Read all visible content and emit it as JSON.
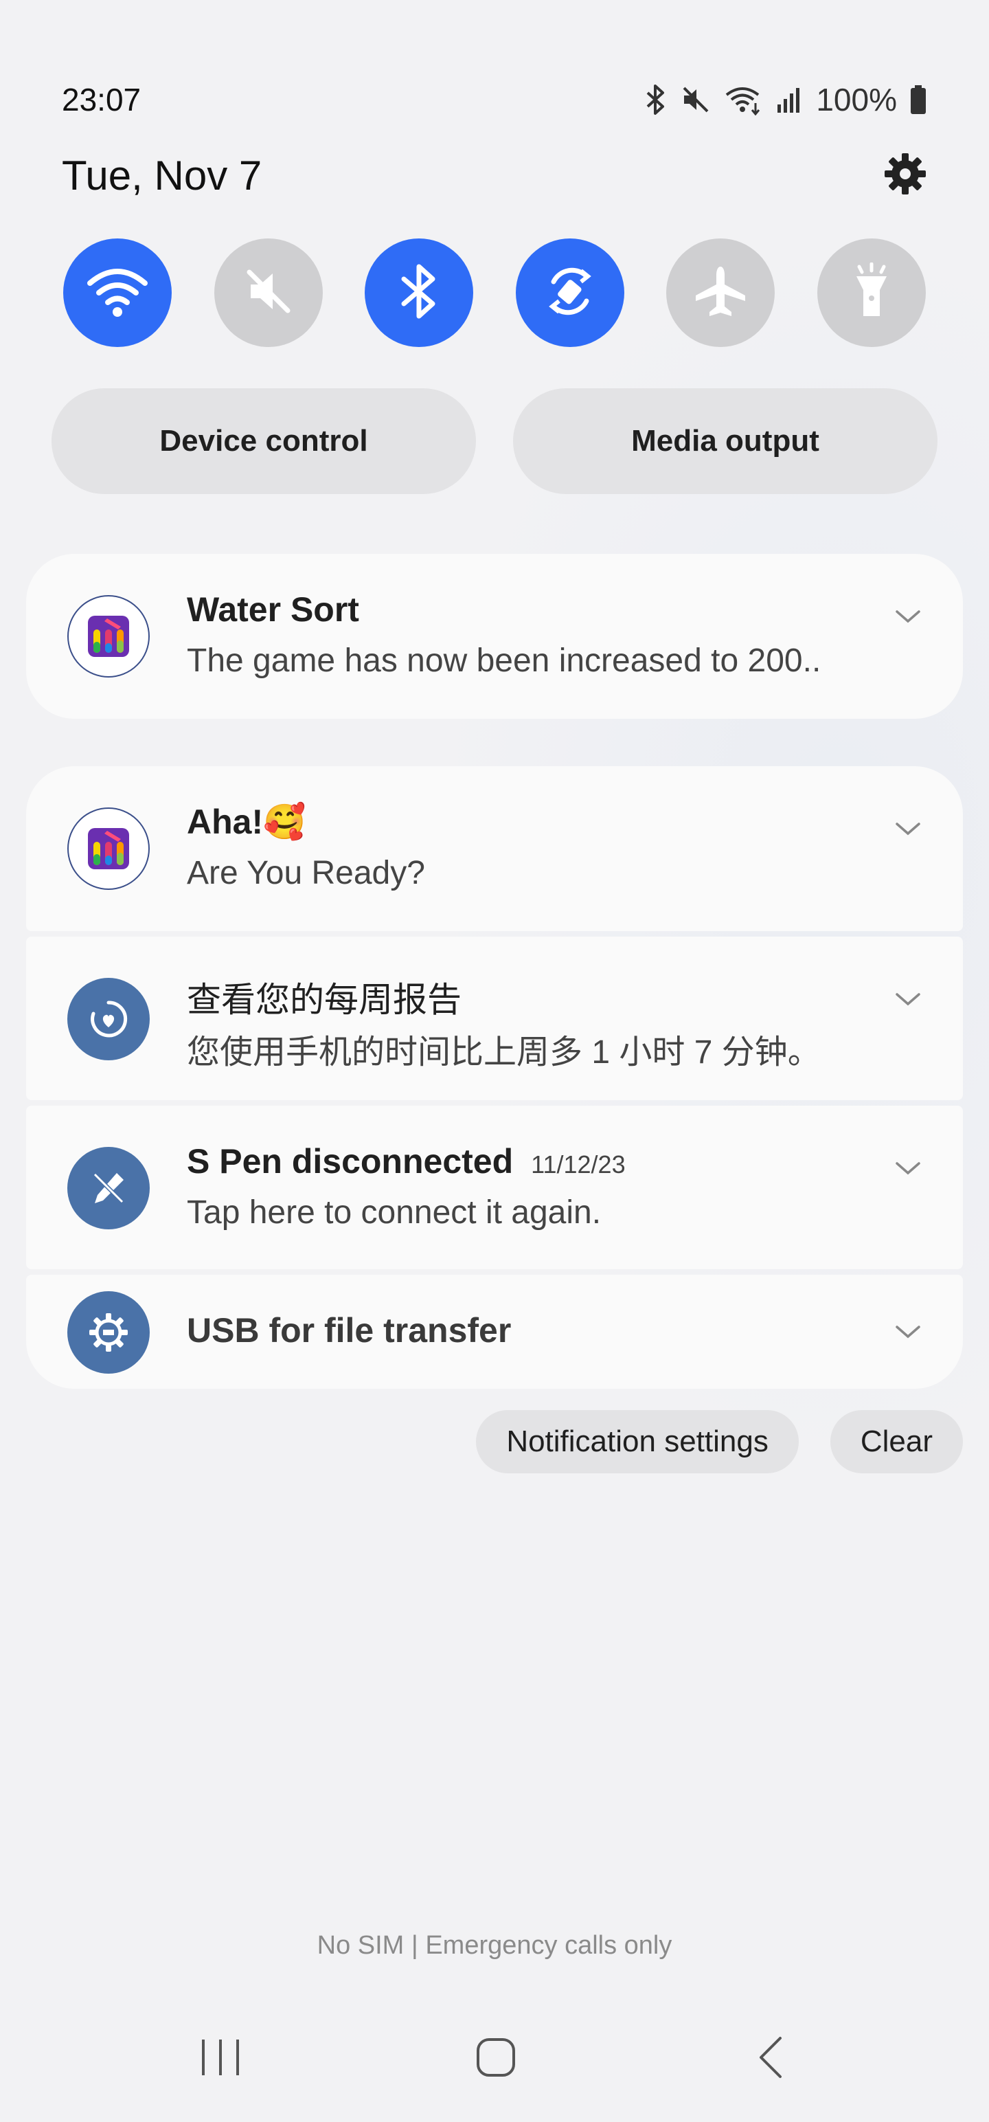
{
  "status_bar": {
    "time": "23:07",
    "battery": "100%",
    "icons": [
      "bluetooth-icon",
      "mute-icon",
      "wifi-icon",
      "signal-icon",
      "battery-icon"
    ]
  },
  "header": {
    "date": "Tue, Nov 7",
    "settings_icon": "gear-icon"
  },
  "quick_toggles": [
    {
      "name": "wifi",
      "on": true
    },
    {
      "name": "sound-mute",
      "on": false
    },
    {
      "name": "bluetooth",
      "on": true
    },
    {
      "name": "auto-rotate",
      "on": true
    },
    {
      "name": "airplane-mode",
      "on": false
    },
    {
      "name": "flashlight",
      "on": false
    }
  ],
  "controls": {
    "device_control": "Device control",
    "media_output": "Media output"
  },
  "notifications": {
    "water_sort": {
      "title": "Water Sort",
      "text": "The game has now been increased to 200.."
    },
    "aha": {
      "title": "Aha!🥰",
      "text": "Are You Ready?"
    },
    "weekly_report": {
      "title": "查看您的每周报告",
      "text": "您使用手机的时间比上周多 1 小时 7 分钟。"
    },
    "s_pen": {
      "title": "S Pen disconnected",
      "date": "11/12/23",
      "text": "Tap here to connect it again."
    },
    "usb": {
      "title": "USB for file transfer"
    }
  },
  "footer": {
    "notification_settings": "Notification settings",
    "clear": "Clear"
  },
  "carrier": "No SIM | Emergency calls only",
  "colors": {
    "accent": "#2f6cf6",
    "toggle_off": "#cfcfd1",
    "system_icon": "#4a72a8"
  }
}
